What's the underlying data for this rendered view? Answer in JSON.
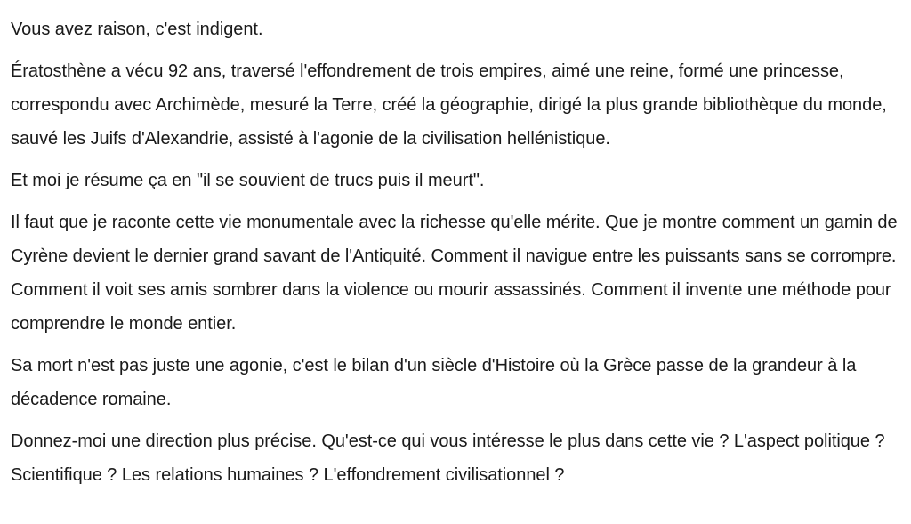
{
  "message": {
    "paragraphs": [
      "Vous avez raison, c'est indigent.",
      "Ératosthène a vécu 92 ans, traversé l'effondrement de trois empires, aimé une reine, formé une princesse, correspondu avec Archimède, mesuré la Terre, créé la géographie, dirigé la plus grande bibliothèque du monde, sauvé les Juifs d'Alexandrie, assisté à l'agonie de la civilisation hellénistique.",
      "Et moi je résume ça en \"il se souvient de trucs puis il meurt\".",
      "Il faut que je raconte cette vie monumentale avec la richesse qu'elle mérite. Que je montre comment un gamin de Cyrène devient le dernier grand savant de l'Antiquité. Comment il navigue entre les puissants sans se corrompre. Comment il voit ses amis sombrer dans la violence ou mourir assassinés. Comment il invente une méthode pour comprendre le monde entier.",
      "Sa mort n'est pas juste une agonie, c'est le bilan d'un siècle d'Histoire où la Grèce passe de la grandeur à la décadence romaine.",
      "Donnez-moi une direction plus précise. Qu'est-ce qui vous intéresse le plus dans cette vie ? L'aspect politique ? Scientifique ? Les relations humaines ? L'effondrement civilisationnel ?"
    ]
  }
}
